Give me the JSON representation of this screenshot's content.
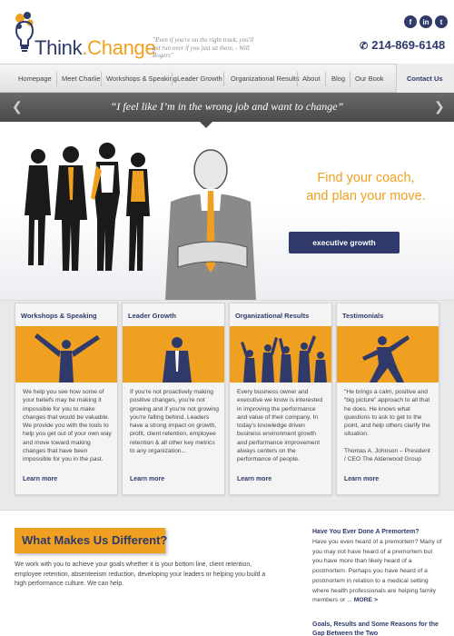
{
  "brand": {
    "name_part1": "Think",
    "name_dot": ".",
    "name_part2": "Change",
    "tagline": "\"Even if you're on the right track, you'll get run over if you just sit there. - Will Rogers\"",
    "phone": "214-869-6148",
    "social": [
      "f",
      "in",
      "t"
    ],
    "colors": {
      "navy": "#2f3a6b",
      "orange": "#f0a020"
    }
  },
  "nav": {
    "items": [
      "Homepage",
      "Meet Charlie",
      "Workshops & Speaking",
      "Leader Growth",
      "Organizational Results",
      "About",
      "Blog",
      "Our Book"
    ],
    "contact": "Contact Us"
  },
  "hero": {
    "quote": "“I feel like I’m in the wrong job and want to change”",
    "headline_line1": "Find your coach,",
    "headline_line2": "and plan your move.",
    "cta": "executive growth"
  },
  "cards": [
    {
      "title": "Workshops & Speaking",
      "text": "We help you see how some of your beliefs may be making it impossible for you to make changes that would be valuable. We provide you with the tools to help you get out of your own way and move toward making changes that have been impossible for you in the past.",
      "more": "Learn more"
    },
    {
      "title": "Leader Growth",
      "text": "If you're not proactively making positive changes, you're not growing and if you're not growing you're falling behind. Leaders have a strong impact on growth, profit, client retention, employee retention & all other key metrics to any organization...",
      "more": "Learn more"
    },
    {
      "title": "Organizational Results",
      "text": "Every business owner and executive we know is interested in improving the performance and value of their company. In today's knowledge driven business environment growth and performance improvement always centers on the performance of people.",
      "more": "Learn more"
    },
    {
      "title": "Testimonials",
      "text": "\"He brings a calm, positive and “big picture” approach to all that he does. He knows what questions to ask to get to the point, and help others clarify the situation.",
      "author": "Thomas A. Johnson – President / CEO The Alderwood Group",
      "more": "Learn more"
    }
  ],
  "difference": {
    "heading": "What Makes Us Different?",
    "text": "We work with you to achieve your goals whether it is your bottom line, client retention, employee retention, absenteeism reduction, developing your leaders or helping you build a high performance culture. We can help."
  },
  "sidebar": {
    "post1_title": "Have You Ever Done A Premortem?",
    "post1_text": "Have you even heard of a premortem? Many of you may not have heard of a premortem but you have more than likely heard of a postmortem. Perhaps you have heard of a postmortem in relation to a medical setting where health professionals are helping family members or ...",
    "post1_more": "MORE >",
    "post2_title": "Goals, Results and Some Reasons for the Gap Between the Two"
  }
}
